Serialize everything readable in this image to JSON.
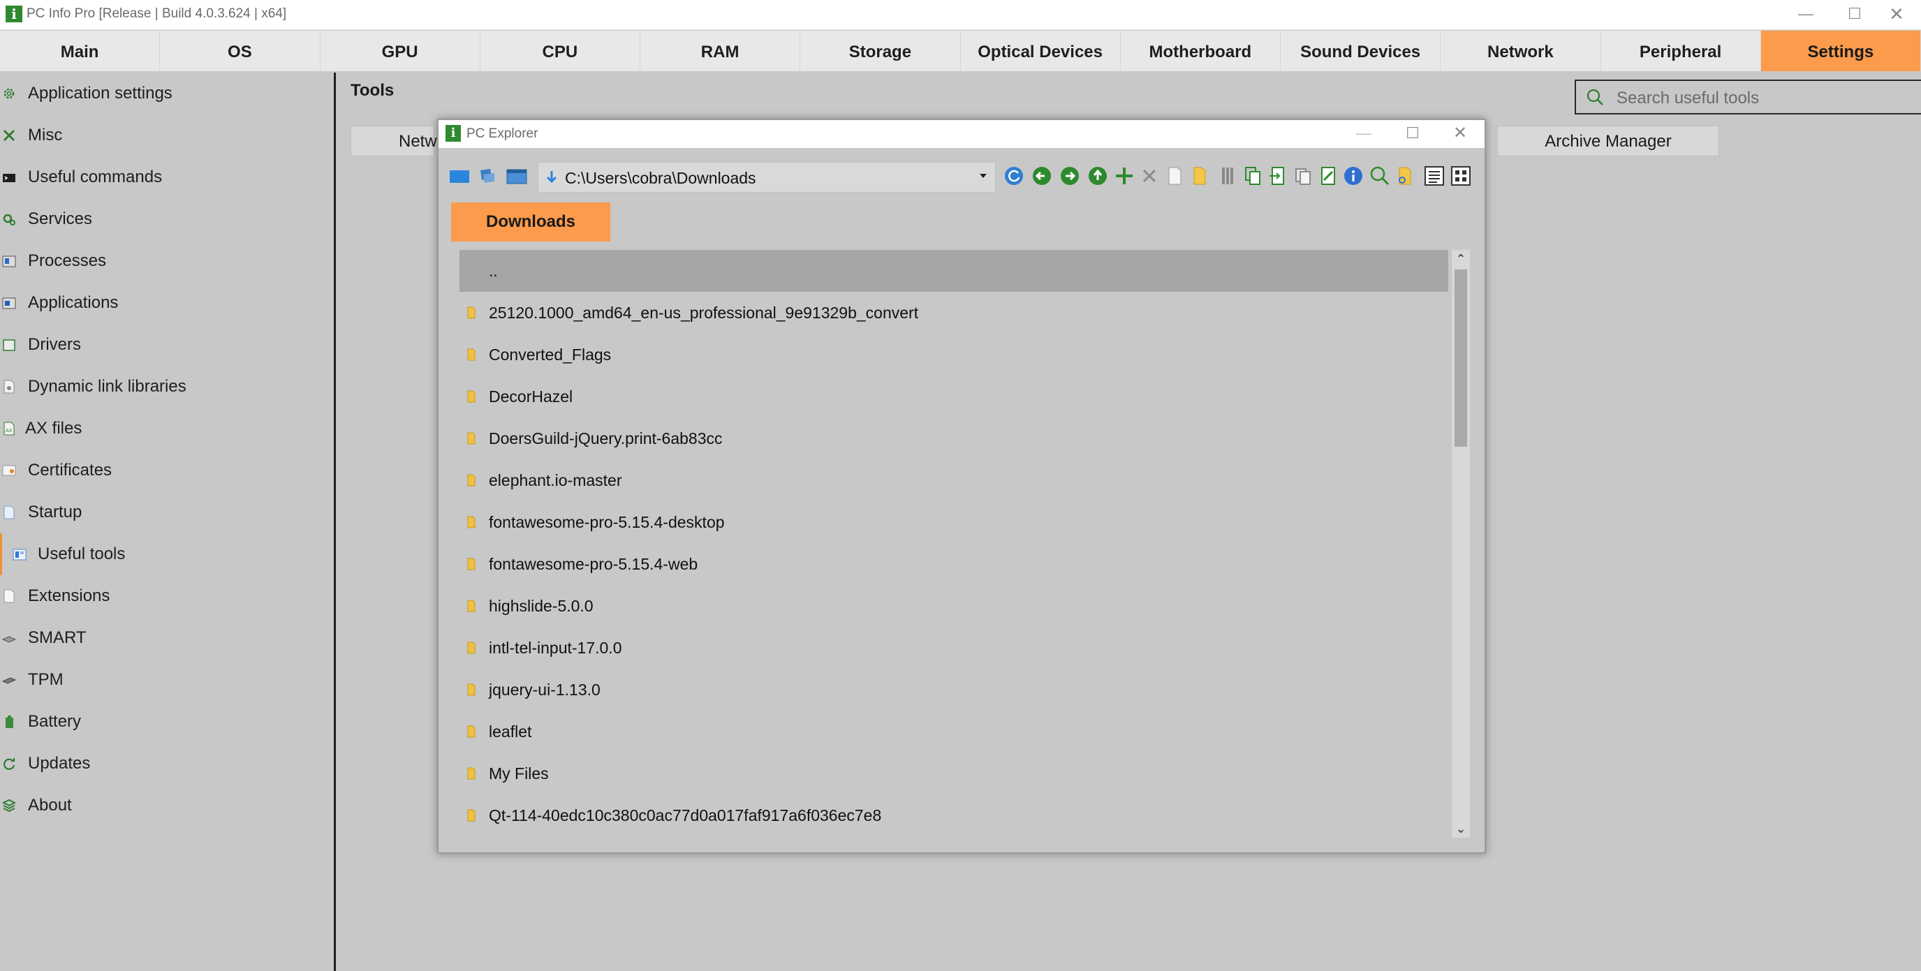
{
  "window": {
    "title": "PC Info Pro [Release | Build 4.0.3.624 | x64]",
    "app_icon_letter": "i"
  },
  "tabs": [
    {
      "label": "Main"
    },
    {
      "label": "OS"
    },
    {
      "label": "GPU"
    },
    {
      "label": "CPU"
    },
    {
      "label": "RAM"
    },
    {
      "label": "Storage"
    },
    {
      "label": "Optical Devices"
    },
    {
      "label": "Motherboard"
    },
    {
      "label": "Sound Devices"
    },
    {
      "label": "Network"
    },
    {
      "label": "Peripheral"
    },
    {
      "label": "Settings",
      "active": true
    }
  ],
  "sidebar": {
    "items": [
      {
        "label": "Application settings",
        "icon": "gear-icon"
      },
      {
        "label": "Misc",
        "icon": "tools-icon"
      },
      {
        "label": "Useful commands",
        "icon": "terminal-icon"
      },
      {
        "label": "Services",
        "icon": "cogs-icon"
      },
      {
        "label": "Processes",
        "icon": "process-icon"
      },
      {
        "label": "Applications",
        "icon": "application-icon"
      },
      {
        "label": "Drivers",
        "icon": "driver-icon"
      },
      {
        "label": "Dynamic link libraries",
        "icon": "dll-icon"
      },
      {
        "label": "AX files",
        "icon": "ax-file-icon"
      },
      {
        "label": "Certificates",
        "icon": "certificate-icon"
      },
      {
        "label": "Startup",
        "icon": "startup-icon"
      },
      {
        "label": "Useful tools",
        "icon": "toolbox-icon",
        "active": true
      },
      {
        "label": "Extensions",
        "icon": "extension-icon"
      },
      {
        "label": "SMART",
        "icon": "disk-icon"
      },
      {
        "label": "TPM",
        "icon": "chip-icon"
      },
      {
        "label": "Battery",
        "icon": "battery-icon"
      },
      {
        "label": "Updates",
        "icon": "refresh-icon"
      },
      {
        "label": "About",
        "icon": "info-layers-icon"
      }
    ]
  },
  "content": {
    "title": "Tools",
    "search_placeholder": "Search useful tools",
    "buttons": {
      "network_partial": "Netw",
      "archive_manager": "Archive Manager"
    }
  },
  "explorer": {
    "title": "PC Explorer",
    "path": "C:\\Users\\cobra\\Downloads",
    "folder_tab": "Downloads",
    "rows": [
      "..",
      "25120.1000_amd64_en-us_professional_9e91329b_convert",
      "Converted_Flags",
      "DecorHazel",
      "DoersGuild-jQuery.print-6ab83cc",
      "elephant.io-master",
      "fontawesome-pro-5.15.4-desktop",
      "fontawesome-pro-5.15.4-web",
      "highslide-5.0.0",
      "intl-tel-input-17.0.0",
      "jquery-ui-1.13.0",
      "leaflet",
      "My Files",
      "Qt-114-40edc10c380c0ac77d0a017faf917a6f036ec7e8"
    ]
  },
  "colors": {
    "accent_orange": "#fb9b4b",
    "app_green": "#2f8a2f",
    "background": "#c8c8c8"
  }
}
